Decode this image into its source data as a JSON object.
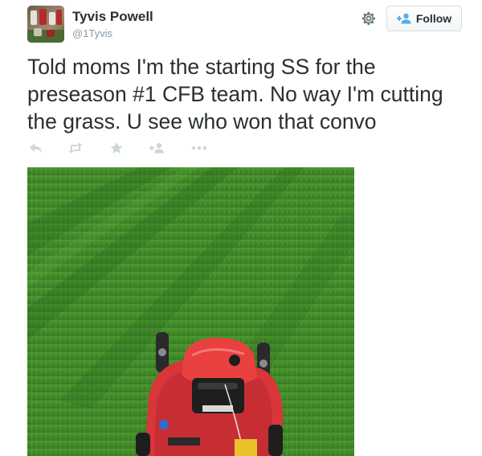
{
  "user": {
    "name": "Tyvis Powell",
    "handle": "@1Tyvis"
  },
  "follow_button": {
    "label": "Follow"
  },
  "tweet": {
    "text": "Told moms I'm the starting SS for the preseason #1 CFB team. No way I'm cutting the grass. U see who won that convo"
  },
  "actions": [
    {
      "icon": "reply-icon"
    },
    {
      "icon": "retweet-icon"
    },
    {
      "icon": "favorite-star-icon"
    },
    {
      "icon": "follow-user-icon"
    },
    {
      "icon": "more-dots-icon"
    }
  ],
  "colors": {
    "text": "#292f33",
    "muted": "#8899a6",
    "action_icons": "#ccd6dd",
    "follow_icon": "#55acee",
    "grass": "#3f8a2a",
    "mower": "#d9363a"
  }
}
